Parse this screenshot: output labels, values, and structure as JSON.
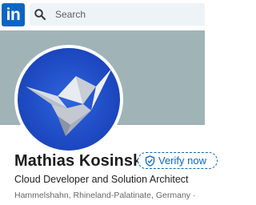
{
  "header": {
    "logo_text": "in",
    "search": {
      "placeholder": "Search",
      "icon": "search-icon"
    }
  },
  "profile": {
    "name": "Mathias Kosinski",
    "verify_label": "Verify now",
    "headline": "Cloud Developer and Solution Architect",
    "location": "Hammelshahn, Rhineland-Palatinate, Germany ·"
  },
  "colors": {
    "brand": "#0a66c2",
    "banner": "#a0b4b7",
    "avatar_background": "#1e4fc8"
  }
}
